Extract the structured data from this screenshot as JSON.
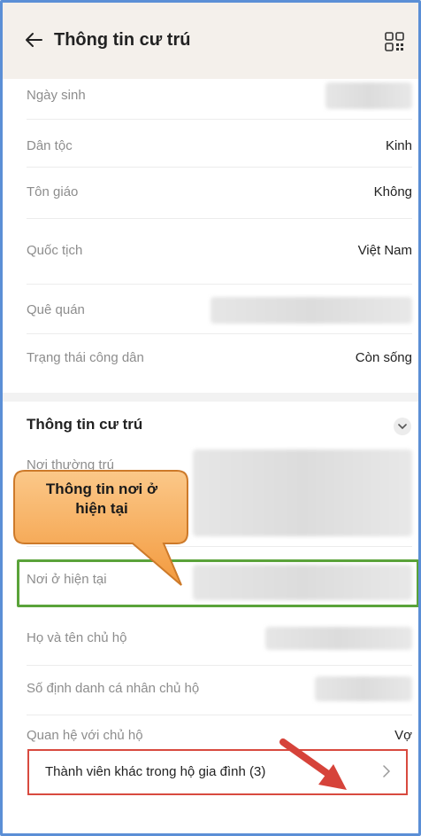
{
  "header": {
    "title": "Thông tin cư trú",
    "back_icon": "arrow-left-icon",
    "qr_icon": "qr-code-icon"
  },
  "personal_rows": [
    {
      "label": "Ngày sinh",
      "value": ""
    },
    {
      "label": "Dân tộc",
      "value": "Kinh"
    },
    {
      "label": "Tôn giáo",
      "value": "Không"
    },
    {
      "label": "Quốc tịch",
      "value": "Việt Nam"
    },
    {
      "label": "Quê quán",
      "value": ""
    },
    {
      "label": "Trạng thái công dân",
      "value": "Còn sống"
    }
  ],
  "residence": {
    "section_title": "Thông tin cư trú",
    "rows": [
      {
        "label": "Nơi thường trú",
        "value": ""
      },
      {
        "label": "Nơi ở hiện tại",
        "value": ""
      },
      {
        "label": "Họ và tên chủ hộ",
        "value": ""
      },
      {
        "label": "Số định danh cá nhân chủ hộ",
        "value": ""
      },
      {
        "label": "Quan hệ với chủ hộ",
        "value": "Vợ"
      }
    ],
    "other_members": "Thành viên khác trong hộ gia đình (3)"
  },
  "annotation": {
    "callout_line1": "Thông tin nơi ở",
    "callout_line2": "hiện tại"
  },
  "colors": {
    "header_bg": "#f4f0eb",
    "highlight_green": "#5aa33a",
    "highlight_red": "#d84a3f",
    "callout_orange": "#f7a24a",
    "arrow_red": "#d6433a",
    "frame_blue": "#5b8fd6"
  }
}
